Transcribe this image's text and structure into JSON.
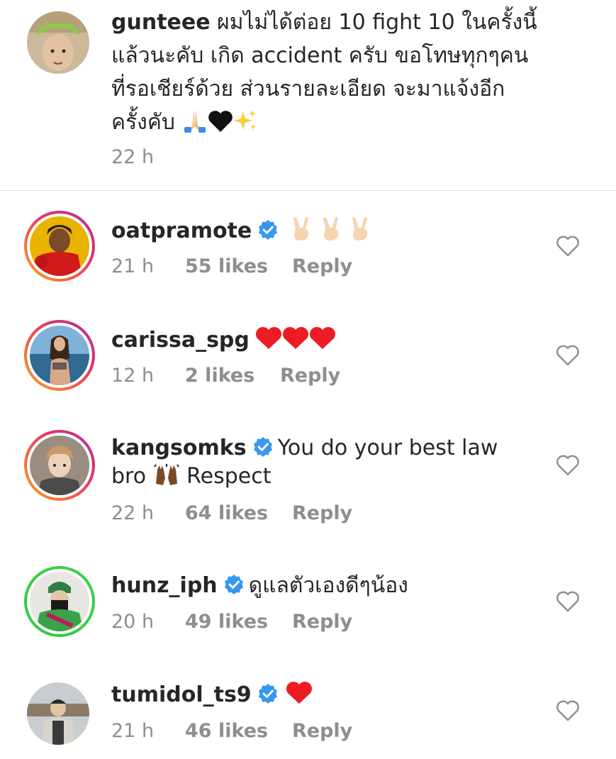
{
  "caption": {
    "username": "gunteee",
    "text": "ผมไม่ได้ต่อย 10 fight 10 ในครั้งนี้แล้วนะคับ เกิด accident ครับ ขอโทษทุกๆคนที่รอเชียร์ด้วย ส่วนรายละเอียด จะมาแจ้งอีกครั้งคับ",
    "line1": " ผมไม่ได้ต่อย 10 fight 10 ในครั้งนี้",
    "line2": "แล้วนะคับ เกิด accident ครับ ขอโทษทุกๆคน",
    "line3": "ที่รอเชียร์ด้วย ส่วนรายละเอียด จะมาแจ้งอีก",
    "line4": "ครั้งคับ",
    "emojis": [
      "folded-hands",
      "black-heart",
      "sparkles"
    ],
    "time": "22 h"
  },
  "comments": [
    {
      "username": "oatpramote",
      "verified": true,
      "text": "",
      "emojis": [
        "victory-hand",
        "victory-hand",
        "victory-hand"
      ],
      "time": "21 h",
      "likes": "55 likes",
      "reply": "Reply",
      "story_ring": "gradient"
    },
    {
      "username": "carissa_spg",
      "verified": false,
      "text": "",
      "emojis": [
        "red-heart",
        "red-heart",
        "red-heart"
      ],
      "time": "12 h",
      "likes": "2 likes",
      "reply": "Reply",
      "story_ring": "gradient"
    },
    {
      "username": "kangsomks",
      "verified": true,
      "text_line1": "You do your best law",
      "text_line2a": "bro",
      "text_line2b": "Respect",
      "emojis": [
        "raising-hands"
      ],
      "time": "22 h",
      "likes": "64 likes",
      "reply": "Reply",
      "story_ring": "gradient"
    },
    {
      "username": "hunz_iph",
      "verified": true,
      "text": "ดูแลตัวเองดีๆน้อง",
      "time": "20 h",
      "likes": "49 likes",
      "reply": "Reply",
      "story_ring": "green"
    },
    {
      "username": "tumidol_ts9",
      "verified": true,
      "text": "",
      "emojis": [
        "red-heart"
      ],
      "time": "21 h",
      "likes": "46 likes",
      "reply": "Reply",
      "story_ring": "none"
    }
  ],
  "colors": {
    "text": "#262626",
    "meta": "#8e8e8e",
    "verified": "#3897f0",
    "heart": "#ed1c24",
    "divider": "#e2e2e2"
  }
}
